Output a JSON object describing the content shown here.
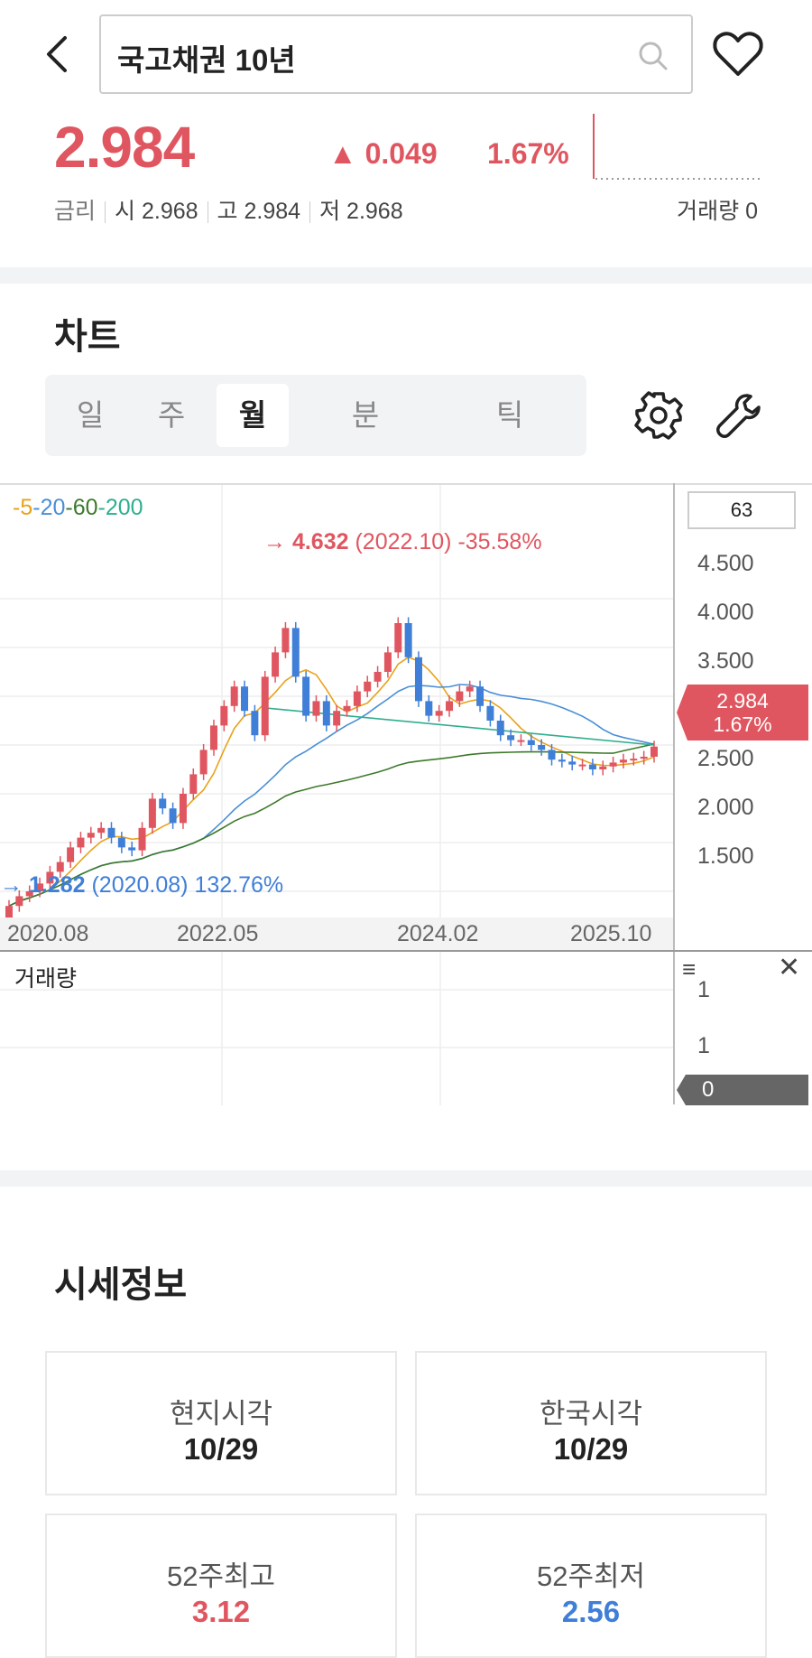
{
  "header": {
    "search_text": "국고채권 10년"
  },
  "quote": {
    "price": "2.984",
    "change": "▲ 0.049",
    "change_pct": "1.67%",
    "rate_label": "금리",
    "open_label": "시",
    "open": "2.968",
    "high_label": "고",
    "high": "2.984",
    "low_label": "저",
    "low": "2.968",
    "volume_label": "거래량",
    "volume": "0"
  },
  "chart_section": {
    "title": "차트",
    "tabs": [
      "일",
      "주",
      "월",
      "분",
      "틱"
    ],
    "active_tab": "월"
  },
  "chart": {
    "ma_legend": [
      {
        "label": "5",
        "color": "#e8a21a"
      },
      {
        "label": "20",
        "color": "#4a8fd6"
      },
      {
        "label": "60",
        "color": "#3d7a2a"
      },
      {
        "label": "200",
        "color": "#2fae8d"
      }
    ],
    "period_box": "63",
    "max_annotation": {
      "value": "4.632",
      "date": "(2022.10)",
      "pct": "-35.58%"
    },
    "min_annotation": {
      "value": "1.282",
      "date": "(2020.08)",
      "pct": "132.76%"
    },
    "current_tag": {
      "price": "2.984",
      "pct": "1.67%"
    },
    "y_ticks": [
      "4.500",
      "4.000",
      "3.500",
      "2.500",
      "2.000",
      "1.500"
    ],
    "x_ticks": [
      "2020.08",
      "2022.05",
      "2024.02",
      "2025.10"
    ],
    "volume_panel": {
      "title": "거래량",
      "ticks": [
        "1",
        "1"
      ],
      "current": "0"
    },
    "colors": {
      "up": "#e05660",
      "down": "#3f7fd8"
    }
  },
  "chart_data": {
    "type": "candlestick",
    "title": "",
    "x_ticks": [
      "2020.08",
      "2022.05",
      "2024.02",
      "2025.10"
    ],
    "ylim": [
      1.2,
      4.8
    ],
    "y_ticks": [
      1.5,
      2.0,
      2.5,
      3.0,
      3.5,
      4.0,
      4.5
    ],
    "series": [
      {
        "name": "price",
        "values": [
          1.35,
          1.45,
          1.5,
          1.58,
          1.7,
          1.8,
          1.95,
          2.05,
          2.1,
          2.15,
          2.05,
          1.95,
          1.92,
          2.15,
          2.45,
          2.35,
          2.2,
          2.5,
          2.7,
          2.95,
          3.2,
          3.4,
          3.6,
          3.35,
          3.1,
          3.7,
          3.95,
          4.2,
          3.7,
          3.3,
          3.45,
          3.2,
          3.35,
          3.4,
          3.55,
          3.65,
          3.75,
          3.95,
          4.25,
          3.9,
          3.45,
          3.3,
          3.35,
          3.45,
          3.55,
          3.6,
          3.4,
          3.25,
          3.1,
          3.05,
          3.05,
          3.0,
          2.95,
          2.85,
          2.83,
          2.8,
          2.8,
          2.75,
          2.78,
          2.82,
          2.85,
          2.86,
          2.88,
          2.984
        ]
      }
    ]
  },
  "market_info": {
    "title": "시세정보",
    "cards": [
      {
        "label": "현지시각",
        "value": "10/29"
      },
      {
        "label": "한국시각",
        "value": "10/29"
      },
      {
        "label": "52주최고",
        "value": "3.12"
      },
      {
        "label": "52주최저",
        "value": "2.56"
      }
    ]
  }
}
